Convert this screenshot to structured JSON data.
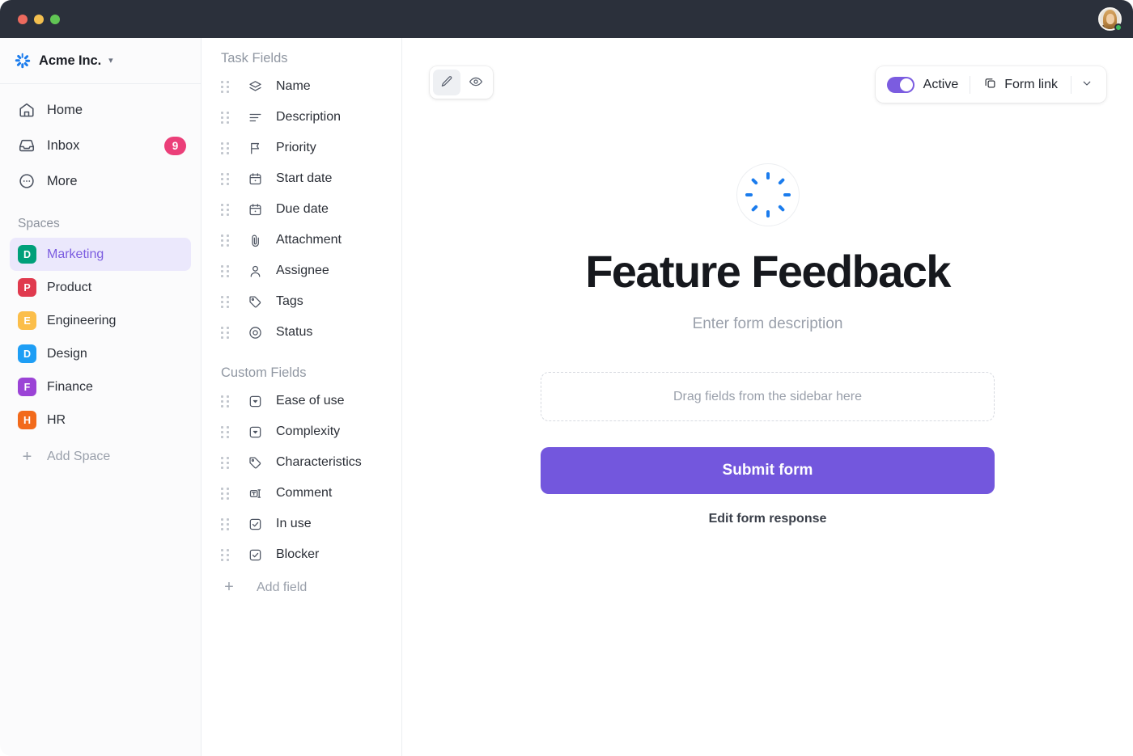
{
  "titlebar": {
    "traffic_lights": [
      "close",
      "minimize",
      "maximize"
    ],
    "avatar_name": "user-avatar",
    "status": "online"
  },
  "sidebar": {
    "workspace": {
      "name": "Acme Inc.",
      "logo": "clickup-spinner-logo",
      "chevron": "ˇ"
    },
    "nav": [
      {
        "label": "Home",
        "icon": "home-icon"
      },
      {
        "label": "Inbox",
        "icon": "inbox-icon",
        "badge": "9"
      },
      {
        "label": "More",
        "icon": "more-icon"
      }
    ],
    "spaces_title": "Spaces",
    "spaces": [
      {
        "label": "Marketing",
        "initial": "D",
        "color": "#00a07a",
        "active": true
      },
      {
        "label": "Product",
        "initial": "P",
        "color": "#e03a4e",
        "active": false
      },
      {
        "label": "Engineering",
        "initial": "E",
        "color": "#fbbe4a",
        "active": false
      },
      {
        "label": "Design",
        "initial": "D",
        "color": "#1e9ef5",
        "active": false
      },
      {
        "label": "Finance",
        "initial": "F",
        "color": "#9b43d6",
        "active": false
      },
      {
        "label": "HR",
        "initial": "H",
        "color": "#f26a1b",
        "active": false
      }
    ],
    "add_space": {
      "label": "Add Space",
      "icon": "plus-icon"
    }
  },
  "fields_panel": {
    "task_fields_title": "Task Fields",
    "task_fields": [
      {
        "label": "Name",
        "icon": "layers-icon"
      },
      {
        "label": "Description",
        "icon": "text-lines-icon"
      },
      {
        "label": "Priority",
        "icon": "flag-icon"
      },
      {
        "label": "Start date",
        "icon": "calendar-icon"
      },
      {
        "label": "Due date",
        "icon": "calendar-icon"
      },
      {
        "label": "Attachment",
        "icon": "paperclip-icon"
      },
      {
        "label": "Assignee",
        "icon": "person-icon"
      },
      {
        "label": "Tags",
        "icon": "tag-icon"
      },
      {
        "label": "Status",
        "icon": "target-icon"
      }
    ],
    "custom_fields_title": "Custom Fields",
    "custom_fields": [
      {
        "label": "Ease of use",
        "icon": "dropdown-icon"
      },
      {
        "label": "Complexity",
        "icon": "dropdown-icon"
      },
      {
        "label": "Characteristics",
        "icon": "tag-icon"
      },
      {
        "label": "Comment",
        "icon": "text-input-icon"
      },
      {
        "label": "In use",
        "icon": "checkbox-icon"
      },
      {
        "label": "Blocker",
        "icon": "checkbox-icon"
      }
    ],
    "add_field": {
      "label": "Add field",
      "icon": "plus-icon"
    }
  },
  "toolbar": {
    "edit_mode": {
      "icon": "pencil-icon",
      "selected": true
    },
    "preview_mode": {
      "icon": "eye-icon",
      "selected": false
    },
    "toggle_state": "on",
    "toggle_label": "Active",
    "form_link_label": "Form link",
    "form_link_icon": "copy-icon",
    "caret_icon": "chevron-down-icon"
  },
  "form": {
    "logo": "clickup-spinner-logo",
    "title": "Feature Feedback",
    "description_placeholder": "Enter form description",
    "dropzone_text": "Drag fields from the sidebar here",
    "submit_label": "Submit form",
    "edit_response_label": "Edit form response"
  },
  "colors": {
    "accent_purple": "#7357dd",
    "active_item_bg": "#ebe8fc",
    "active_item_text": "#7b5ce0",
    "badge_pink": "#eb3f79",
    "logo_blue": "#1b7ced",
    "titlebar": "#2b303b"
  }
}
